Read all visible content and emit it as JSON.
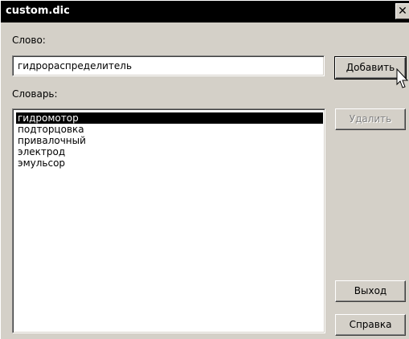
{
  "window": {
    "title": "custom.dic",
    "close_glyph": "✕"
  },
  "word": {
    "label": "Слово:",
    "value": "гидрораспределитель"
  },
  "dictionary": {
    "label": "Словарь:",
    "items": [
      "гидромотор",
      "подторцовка",
      "привалочный",
      "электрод",
      "эмульсор"
    ],
    "selected_index": 0
  },
  "buttons": {
    "add": "Добавить",
    "delete": "Удалить",
    "exit": "Выход",
    "help": "Справка"
  },
  "icons": {
    "cursor": "arrow-cursor-icon"
  }
}
